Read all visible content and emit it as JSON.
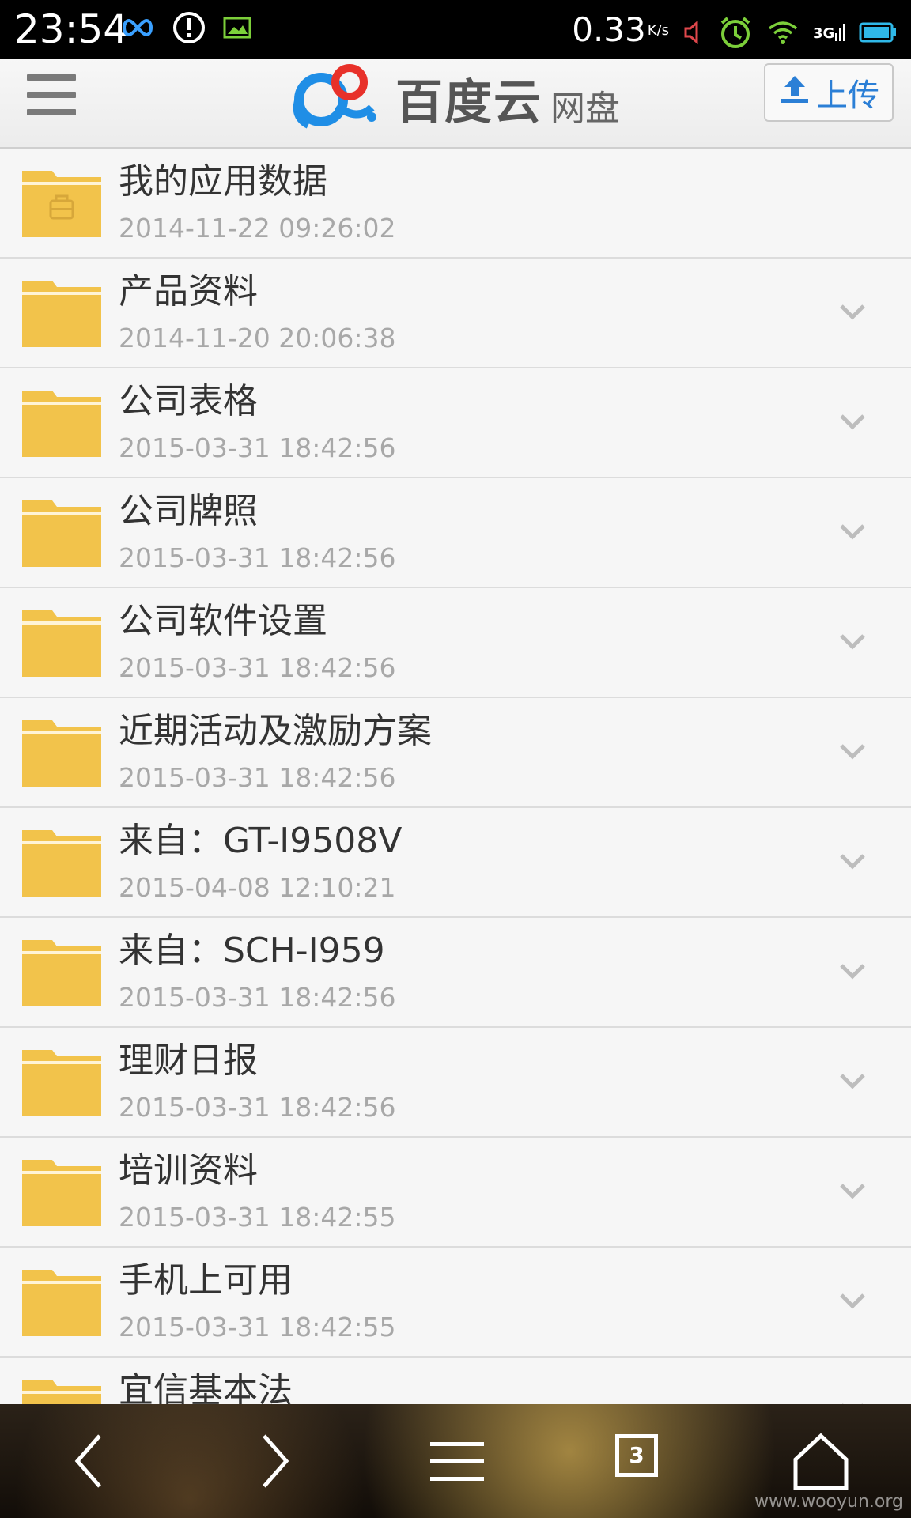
{
  "status_bar": {
    "time": "23:54",
    "speed": "0.33",
    "speed_unit": "K/s",
    "icons_left": [
      "infinity-icon",
      "alert-icon",
      "image-icon"
    ],
    "icons_right": [
      "mute-icon",
      "alarm-icon",
      "wifi-icon",
      "signal-3g-icon",
      "battery-icon"
    ]
  },
  "header": {
    "brand": "百度云",
    "brand_sub": "网盘",
    "upload_label": "上传"
  },
  "colors": {
    "folder": "#f2c34b",
    "accent": "#2b7fd6",
    "date": "#a8a8a8"
  },
  "files": [
    {
      "name": "我的应用数据",
      "date": "2014-11-22 09:26:02",
      "icon": "locked-folder-icon",
      "has_menu": false
    },
    {
      "name": "产品资料",
      "date": "2014-11-20 20:06:38",
      "icon": "folder-icon",
      "has_menu": true
    },
    {
      "name": "公司表格",
      "date": "2015-03-31 18:42:56",
      "icon": "folder-icon",
      "has_menu": true
    },
    {
      "name": "公司牌照",
      "date": "2015-03-31 18:42:56",
      "icon": "folder-icon",
      "has_menu": true
    },
    {
      "name": "公司软件设置",
      "date": "2015-03-31 18:42:56",
      "icon": "folder-icon",
      "has_menu": true
    },
    {
      "name": "近期活动及激励方案",
      "date": "2015-03-31 18:42:56",
      "icon": "folder-icon",
      "has_menu": true
    },
    {
      "name": "来自：GT-I9508V",
      "date": "2015-04-08 12:10:21",
      "icon": "folder-icon",
      "has_menu": true
    },
    {
      "name": "来自：SCH-I959",
      "date": "2015-03-31 18:42:56",
      "icon": "folder-icon",
      "has_menu": true
    },
    {
      "name": "理财日报",
      "date": "2015-03-31 18:42:56",
      "icon": "folder-icon",
      "has_menu": true
    },
    {
      "name": "培训资料",
      "date": "2015-03-31 18:42:55",
      "icon": "folder-icon",
      "has_menu": true
    },
    {
      "name": "手机上可用",
      "date": "2015-03-31 18:42:55",
      "icon": "folder-icon",
      "has_menu": true
    },
    {
      "name": "宜信基本法",
      "date": "",
      "icon": "folder-icon",
      "has_menu": true
    }
  ],
  "bottom_nav": {
    "tabs_count": "3",
    "watermark": "www.wooyun.org"
  }
}
